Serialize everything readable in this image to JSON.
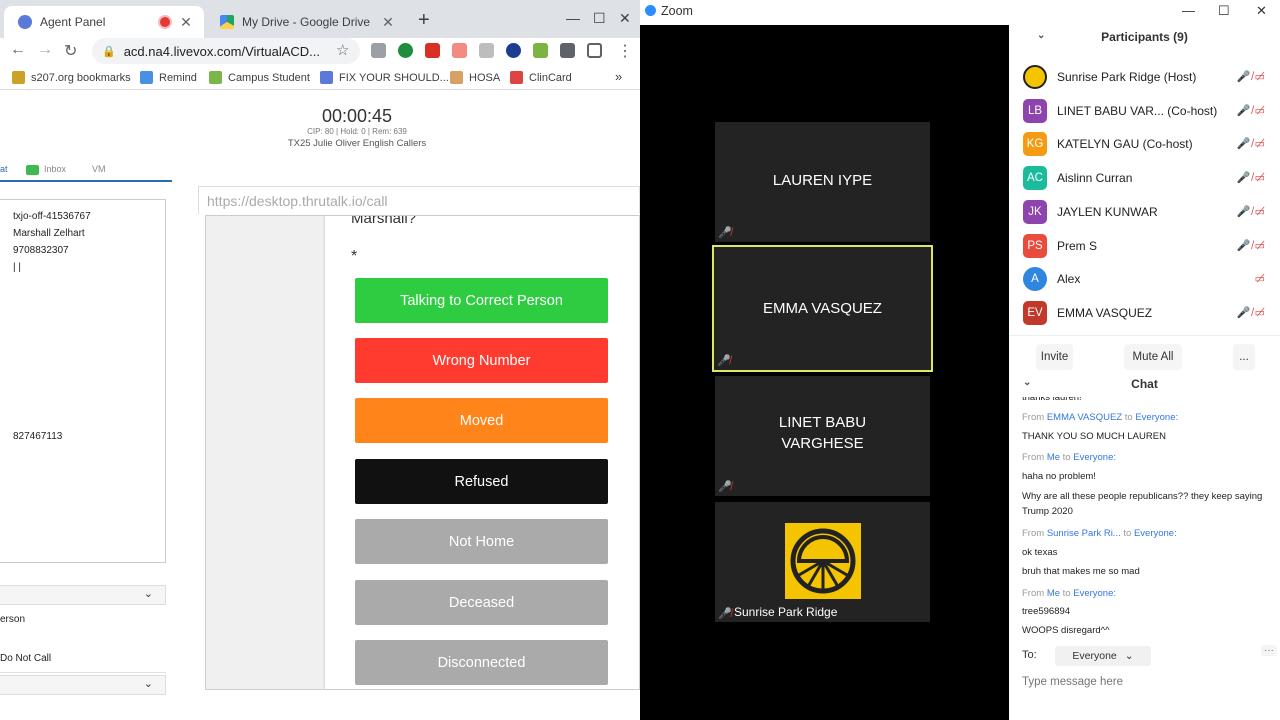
{
  "browser": {
    "tabs": [
      {
        "title": "Agent Panel",
        "close": "✕"
      },
      {
        "title": "My Drive - Google Drive",
        "close": "✕"
      }
    ],
    "new_tab": "+",
    "window_controls": {
      "minimize": "—",
      "maximize": "☐",
      "close": "✕"
    },
    "nav": {
      "back": "←",
      "forward": "→",
      "reload": "↻"
    },
    "url": "acd.na4.livevox.com/VirtualACD...",
    "star": "☆",
    "menu": "⋮",
    "bookmarks": [
      {
        "label": "s207.org bookmarks",
        "color": "#c9a227"
      },
      {
        "label": "Remind",
        "color": "#4a90e2"
      },
      {
        "label": "Campus Student",
        "color": "#7ab648"
      },
      {
        "label": "FIX YOUR SHOULD...",
        "color": "#5b79d8"
      },
      {
        "label": "HOSA",
        "color": "#d9a066"
      },
      {
        "label": "ClinCard",
        "color": "#d44"
      }
    ],
    "bookmarks_more": "»"
  },
  "agent": {
    "timer": "00:00:45",
    "stats": "CIP: 80 | Hold: 0 | Rem: 639",
    "campaign": "TX25 Julie Oliver English Callers",
    "tabs": {
      "active": "at",
      "inbox": "Inbox",
      "vm": "VM"
    },
    "info_lines": [
      "txjo-off-41536767",
      "Marshall Zelhart",
      "9708832307",
      "| |"
    ],
    "info_number": "827467113",
    "chevron": "⌄",
    "term_partial_1": "erson",
    "term_partial_2": "Do Not Call"
  },
  "script": {
    "frame_url": "https://desktop.thrutalk.io/call",
    "question": "Marshall?",
    "required_mark": "*",
    "buttons": [
      {
        "label": "Talking to Correct Person",
        "color": "#2ecc40"
      },
      {
        "label": "Wrong Number",
        "color": "#ff3b30"
      },
      {
        "label": "Moved",
        "color": "#ff851b"
      },
      {
        "label": "Refused",
        "color": "#111111"
      },
      {
        "label": "Not Home",
        "color": "#aaaaaa"
      },
      {
        "label": "Deceased",
        "color": "#aaaaaa"
      },
      {
        "label": "Disconnected",
        "color": "#aaaaaa"
      }
    ]
  },
  "zoom": {
    "title": "Zoom",
    "window_controls": {
      "minimize": "—",
      "maximize": "☐",
      "close": "✕"
    },
    "tiles": [
      {
        "name": "LAUREN IYPE"
      },
      {
        "name": "EMMA VASQUEZ"
      },
      {
        "name": "LINET BABU VARGHESE"
      },
      {
        "name": "Sunrise Park Ridge"
      }
    ],
    "participants_header": "Participants (9)",
    "participants": [
      {
        "initials": "",
        "name": "Sunrise Park Ridge (Host)",
        "color": "#f5c400"
      },
      {
        "initials": "LB",
        "name": "LINET BABU VAR... (Co-host)",
        "color": "#8e44ad"
      },
      {
        "initials": "KG",
        "name": "KATELYN GAU (Co-host)",
        "color": "#f39c12"
      },
      {
        "initials": "AC",
        "name": "Aislinn Curran",
        "color": "#1abc9c"
      },
      {
        "initials": "JK",
        "name": "JAYLEN KUNWAR",
        "color": "#8e44ad"
      },
      {
        "initials": "PS",
        "name": "Prem S",
        "color": "#e74c3c"
      },
      {
        "initials": "A",
        "name": "Alex",
        "color": "#2e86de"
      },
      {
        "initials": "EV",
        "name": "EMMA VASQUEZ",
        "color": "#c0392b"
      }
    ],
    "participant_buttons": {
      "invite": "Invite",
      "mute_all": "Mute All",
      "more": "..."
    },
    "chat_header": "Chat",
    "chat": [
      {
        "kind": "text",
        "text": "thanks lauren!"
      },
      {
        "kind": "from",
        "from": "From",
        "sender": "EMMA VASQUEZ",
        "to": "to",
        "target": "Everyone:"
      },
      {
        "kind": "text",
        "text": "THANK YOU SO MUCH LAUREN"
      },
      {
        "kind": "from",
        "from": "From",
        "sender": "Me",
        "to": "to",
        "target": "Everyone:"
      },
      {
        "kind": "text",
        "text": "haha no problem!"
      },
      {
        "kind": "text",
        "text": "Why are all these people republicans?? they keep saying Trump 2020"
      },
      {
        "kind": "from",
        "from": "From",
        "sender": "Sunrise Park Ri...",
        "to": "to",
        "target": "Everyone:"
      },
      {
        "kind": "text",
        "text": "ok texas"
      },
      {
        "kind": "text",
        "text": "bruh that makes me so mad"
      },
      {
        "kind": "from",
        "from": "From",
        "sender": "Me",
        "to": "to",
        "target": "Everyone:"
      },
      {
        "kind": "text",
        "text": "tree596894"
      },
      {
        "kind": "text",
        "text": "WOOPS disregard^^"
      }
    ],
    "to_label": "To:",
    "to_value": "Everyone",
    "chat_more": "···",
    "chat_placeholder": "Type message here"
  }
}
